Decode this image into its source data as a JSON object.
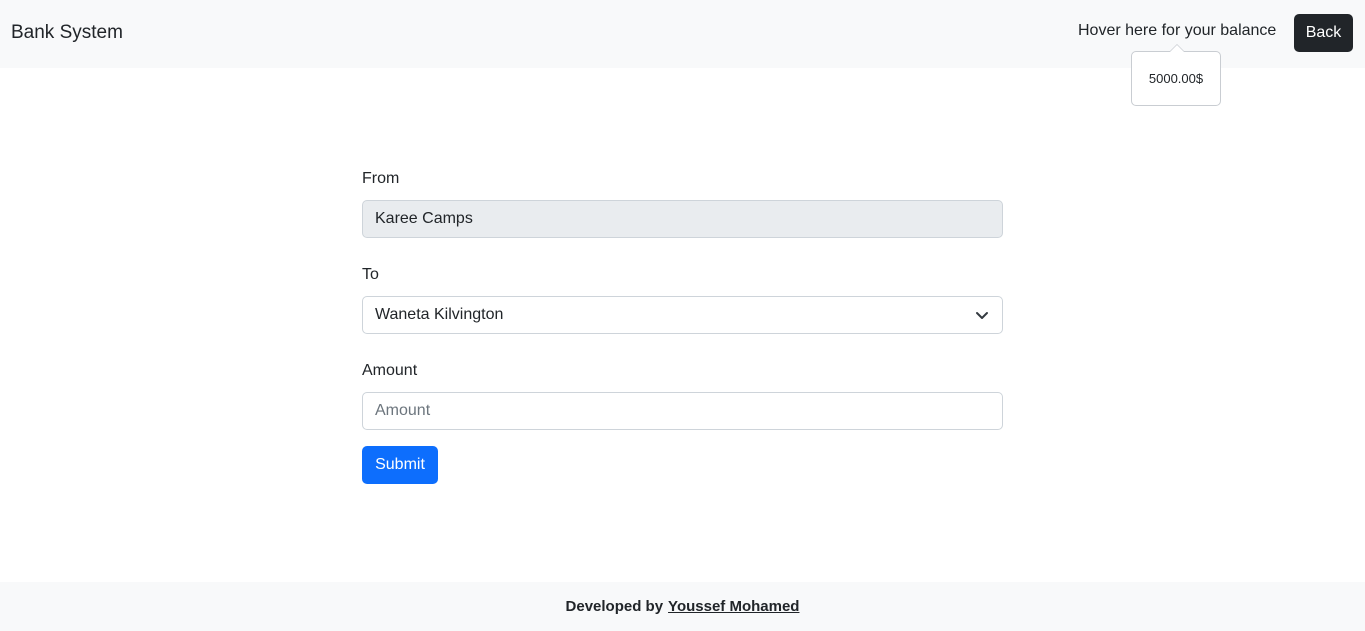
{
  "navbar": {
    "brand": "Bank System",
    "hover_text": "Hover here for your balance",
    "back_label": "Back",
    "balance_popover": "5000.00$"
  },
  "form": {
    "from_label": "From",
    "from_value": "Karee Camps",
    "to_label": "To",
    "to_selected": "Waneta Kilvington",
    "amount_label": "Amount",
    "amount_placeholder": "Amount",
    "submit_label": "Submit"
  },
  "footer": {
    "prefix": "Developed by",
    "author_link": "Youssef Mohamed"
  },
  "icons": {
    "select_arrow": "chevron-down-icon"
  }
}
